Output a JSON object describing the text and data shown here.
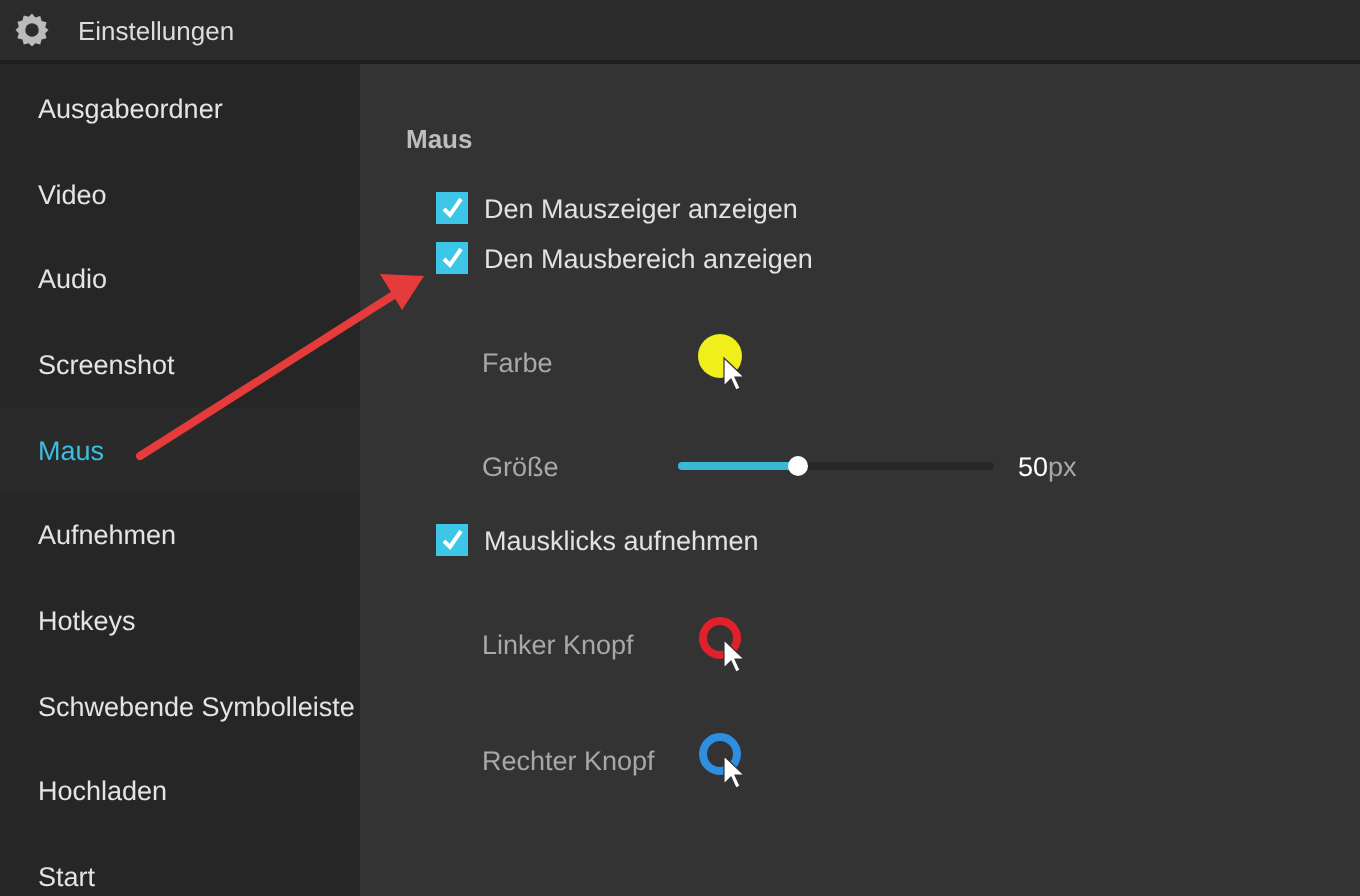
{
  "window": {
    "title": "Einstellungen"
  },
  "sidebar": {
    "items": [
      {
        "label": "Ausgabeordner",
        "selected": false
      },
      {
        "label": "Video",
        "selected": false
      },
      {
        "label": "Audio",
        "selected": false
      },
      {
        "label": "Screenshot",
        "selected": false
      },
      {
        "label": "Maus",
        "selected": true
      },
      {
        "label": "Aufnehmen",
        "selected": false
      },
      {
        "label": "Hotkeys",
        "selected": false
      },
      {
        "label": "Schwebende Symbolleiste",
        "selected": false
      },
      {
        "label": "Hochladen",
        "selected": false
      },
      {
        "label": "Start",
        "selected": false
      }
    ]
  },
  "section": {
    "heading": "Maus",
    "settings": [
      {
        "kind": "checkbox",
        "label": "Den Mauszeiger anzeigen",
        "checked": true
      },
      {
        "kind": "checkbox",
        "label": "Den Mausbereich anzeigen",
        "checked": true
      },
      {
        "kind": "swatch",
        "label": "Farbe",
        "color": "#f0ef1c"
      },
      {
        "kind": "slider",
        "label": "Größe",
        "level": 0.38,
        "reading": "50",
        "unit": "px"
      },
      {
        "kind": "checkbox",
        "label": "Mausklicks aufnehmen",
        "checked": true
      },
      {
        "kind": "ring",
        "label": "Linker Knopf",
        "color": "#e0202a"
      },
      {
        "kind": "ring",
        "label": "Rechter Knopf",
        "color": "#2e8fe0"
      }
    ]
  }
}
